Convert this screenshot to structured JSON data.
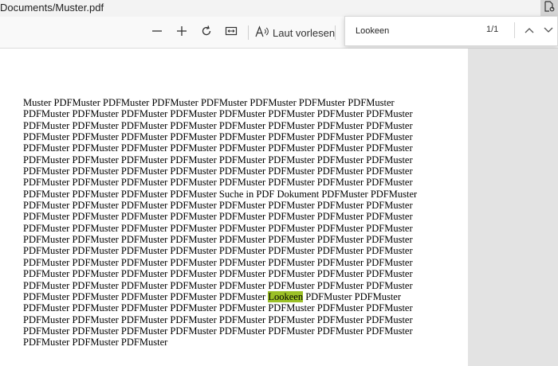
{
  "window": {
    "title": "Documents/Muster.pdf"
  },
  "toolbar": {
    "read_aloud_label": "Laut vorlesen"
  },
  "find": {
    "query": "Lookeen",
    "count": "1/1"
  },
  "document": {
    "lines": [
      {
        "text": "Muster PDFMuster PDFMuster PDFMuster PDFMuster PDFMuster PDFMuster PDFMuster"
      },
      {
        "text": "PDFMuster PDFMuster PDFMuster PDFMuster PDFMuster PDFMuster PDFMuster PDFMuster"
      },
      {
        "text": "PDFMuster PDFMuster PDFMuster PDFMuster PDFMuster PDFMuster PDFMuster PDFMuster"
      },
      {
        "text": "PDFMuster PDFMuster PDFMuster PDFMuster PDFMuster PDFMuster PDFMuster PDFMuster"
      },
      {
        "text": "PDFMuster PDFMuster PDFMuster PDFMuster PDFMuster PDFMuster PDFMuster PDFMuster"
      },
      {
        "text": "PDFMuster PDFMuster PDFMuster PDFMuster PDFMuster PDFMuster PDFMuster PDFMuster"
      },
      {
        "text": "PDFMuster PDFMuster PDFMuster PDFMuster PDFMuster PDFMuster PDFMuster PDFMuster"
      },
      {
        "text": "PDFMuster PDFMuster PDFMuster PDFMuster PDFMuster PDFMuster PDFMuster PDFMuster"
      },
      {
        "text": "PDFMuster PDFMuster PDFMuster PDFMuster Suche in PDF Dokument PDFMuster PDFMuster"
      },
      {
        "text": "PDFMuster PDFMuster PDFMuster PDFMuster PDFMuster PDFMuster PDFMuster PDFMuster"
      },
      {
        "text": "PDFMuster PDFMuster PDFMuster PDFMuster PDFMuster PDFMuster PDFMuster PDFMuster"
      },
      {
        "text": "PDFMuster PDFMuster PDFMuster PDFMuster PDFMuster PDFMuster PDFMuster PDFMuster"
      },
      {
        "text": "PDFMuster PDFMuster PDFMuster PDFMuster PDFMuster PDFMuster PDFMuster PDFMuster"
      },
      {
        "text": "PDFMuster PDFMuster PDFMuster PDFMuster PDFMuster PDFMuster PDFMuster PDFMuster"
      },
      {
        "text": "PDFMuster PDFMuster PDFMuster PDFMuster PDFMuster PDFMuster PDFMuster PDFMuster"
      },
      {
        "text": "PDFMuster PDFMuster PDFMuster PDFMuster PDFMuster PDFMuster PDFMuster PDFMuster"
      },
      {
        "text": "PDFMuster PDFMuster PDFMuster PDFMuster PDFMuster PDFMuster PDFMuster PDFMuster"
      },
      {
        "before": "PDFMuster PDFMuster PDFMuster PDFMuster PDFMuster ",
        "highlight": "Lookeen",
        "after": " PDFMuster PDFMuster"
      },
      {
        "text": "PDFMuster PDFMuster PDFMuster PDFMuster PDFMuster PDFMuster PDFMuster PDFMuster"
      },
      {
        "text": "PDFMuster PDFMuster PDFMuster PDFMuster PDFMuster PDFMuster PDFMuster PDFMuster"
      },
      {
        "text": "PDFMuster PDFMuster PDFMuster PDFMuster PDFMuster PDFMuster PDFMuster PDFMuster"
      },
      {
        "text": "PDFMuster PDFMuster PDFMuster"
      }
    ]
  },
  "colors": {
    "highlight": "#9bc026"
  }
}
